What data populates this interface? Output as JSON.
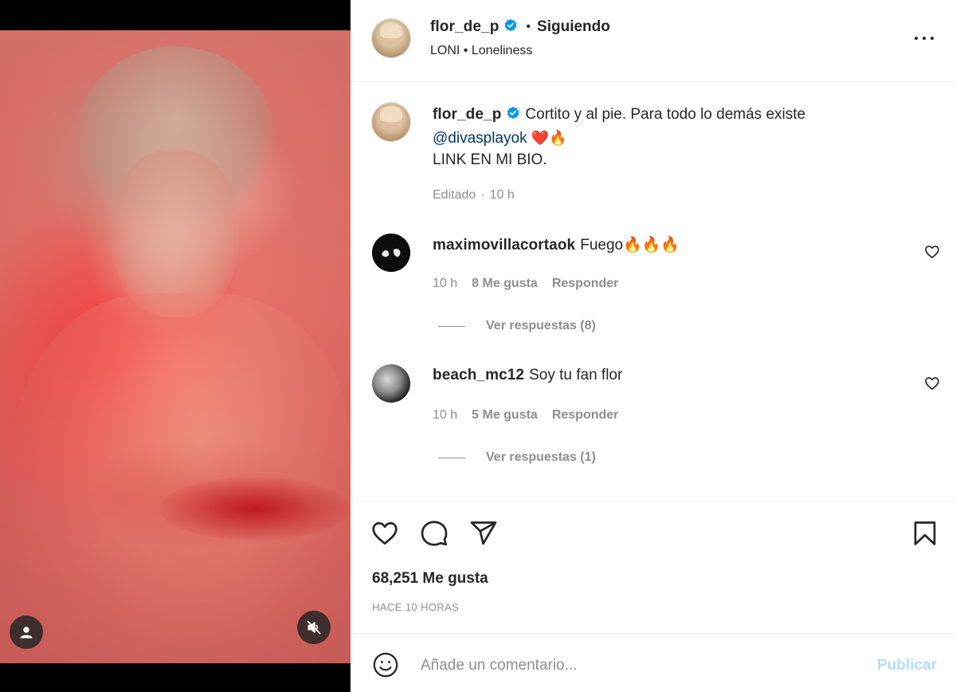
{
  "post": {
    "author": "flor_de_p",
    "follow_status": "Siguiendo",
    "audio": "LONI • Loneliness"
  },
  "caption": {
    "author": "flor_de_p",
    "text": "Cortito y al pie. Para todo lo demás existe",
    "mention": "@divasplayok",
    "emojis": "❤️🔥",
    "line3": "LINK EN MI BIO.",
    "edited": "Editado",
    "time": "10 h"
  },
  "comments": [
    {
      "username": "maximovillacortaok",
      "text": "Fuego🔥🔥🔥",
      "time": "10 h",
      "likes": "8 Me gusta",
      "reply": "Responder",
      "view_replies": "Ver respuestas (8)"
    },
    {
      "username": "beach_mc12",
      "text": "Soy tu fan flor",
      "time": "10 h",
      "likes": "5 Me gusta",
      "reply": "Responder",
      "view_replies": "Ver respuestas (1)"
    }
  ],
  "stats": {
    "likes": "68,251 Me gusta",
    "posted": "HACE 10 HORAS"
  },
  "composer": {
    "placeholder": "Añade un comentario...",
    "publish": "Publicar"
  },
  "icons": {
    "verified": "verified-badge-icon",
    "more": "more-options-icon",
    "heart": "heart-icon",
    "comment": "comment-icon",
    "share": "share-icon",
    "save": "bookmark-icon",
    "emoji": "emoji-icon",
    "user_tag": "user-tag-icon",
    "mute": "muted-audio-icon"
  },
  "colors": {
    "verified": "#0095f6",
    "link": "#00376b",
    "secondary_text": "#8e8e8e",
    "publish_disabled": "#b3dbff"
  }
}
